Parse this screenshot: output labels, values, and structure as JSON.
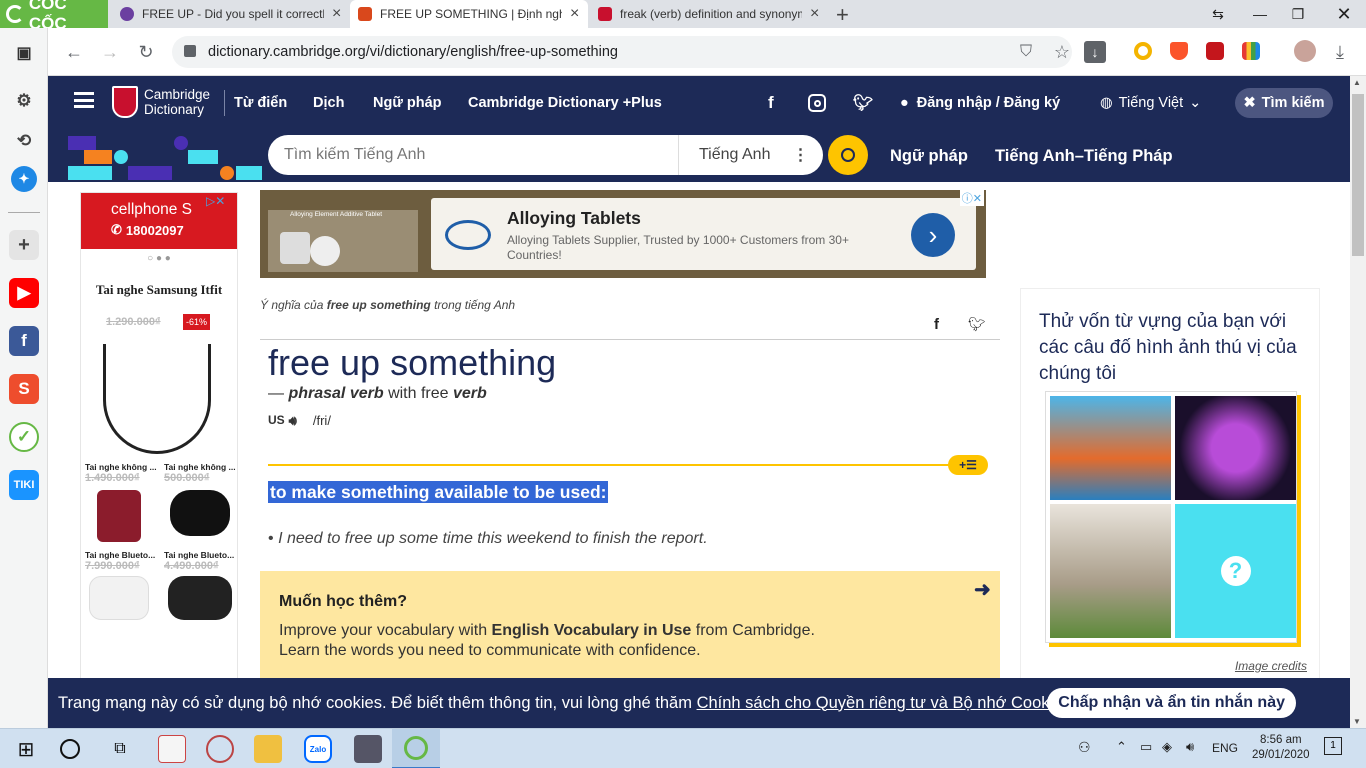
{
  "browser": {
    "brand": "CỐC CỐC",
    "tabs": [
      {
        "title": "FREE UP - Did you spell it correctly",
        "favicon_color": "#6b3fa0",
        "active": false
      },
      {
        "title": "FREE UP SOMETHING | Định nghĩa",
        "favicon_color": "#d9481c",
        "active": true
      },
      {
        "title": "freak (verb) definition and synonym",
        "favicon_color": "#c8102e",
        "active": false
      }
    ],
    "new_tab": "+",
    "url": "dictionary.cambridge.org/vi/dictionary/english/free-up-something"
  },
  "site": {
    "logo_line1": "Cambridge",
    "logo_line2": "Dictionary",
    "nav": [
      "Từ điển",
      "Dịch",
      "Ngữ pháp",
      "Cambridge Dictionary +Plus"
    ],
    "login": "Đăng nhập / Đăng ký",
    "language": "Tiếng Việt",
    "search_button": "Tìm kiếm",
    "search_placeholder": "Tìm kiếm Tiếng Anh",
    "search_lang": "Tiếng Anh",
    "sub_nav": [
      "Ngữ pháp",
      "Tiếng Anh–Tiếng Pháp"
    ]
  },
  "top_ad": {
    "title": "Alloying Tablets",
    "subtitle": "Alloying Tablets Supplier, Trusted by 1000+ Customers from 30+ Countries!",
    "image_caption": "Alloying Element Additive Tablet"
  },
  "left_ad": {
    "brand": "cellphone S",
    "phone": "18002097",
    "product": "Tai nghe Samsung Itfit",
    "old_price": "1.290.000₫",
    "discount": "-61%",
    "items": [
      {
        "label": "Tai nghe không ...",
        "price": "1.490.000₫"
      },
      {
        "label": "Tai nghe không ...",
        "price": "500.000₫"
      },
      {
        "label": "Tai nghe Blueto...",
        "price": "7.990.000₫"
      },
      {
        "label": "Tai nghe Blueto...",
        "price": "4.490.000₫"
      }
    ]
  },
  "entry": {
    "breadcrumb_prefix": "Ý nghĩa của",
    "breadcrumb_word": "free up something",
    "breadcrumb_suffix": "trong tiếng Anh",
    "headword": "free up something",
    "pos_dash": "—",
    "pos": "phrasal verb",
    "pos_with": "with free",
    "pos_verb": "verb",
    "region": "US",
    "ipa": "/fri/",
    "definition": "to make something available to be used:",
    "example": "I need to free up some time this weekend to finish the report."
  },
  "learn_more": {
    "title": "Muốn học thêm?",
    "line1_pre": "Improve your vocabulary with",
    "line1_bold": "English Vocabulary in Use",
    "line1_post": "from Cambridge.",
    "line2": "Learn the words you need to communicate with confidence."
  },
  "quiz": {
    "text": "Thử vốn từ vựng của bạn với các câu đố hình ảnh thú vị của chúng tôi",
    "credits": "Image credits"
  },
  "cookie": {
    "text": "Trang mạng này có sử dụng bộ nhớ cookies. Để biết thêm thông tin, vui lòng ghé thăm",
    "link": "Chính sách cho Quyền riêng tư và Bộ nhớ Cookies",
    "period": ".",
    "button": "Chấp nhận và ẩn tin nhắn này"
  },
  "taskbar": {
    "lang": "ENG",
    "time": "8:56 am",
    "date": "29/01/2020",
    "notif_count": "1"
  },
  "colors": {
    "brand_navy": "#1d2a57",
    "accent_yellow": "#fec400",
    "highlight_blue": "#3367d6"
  }
}
